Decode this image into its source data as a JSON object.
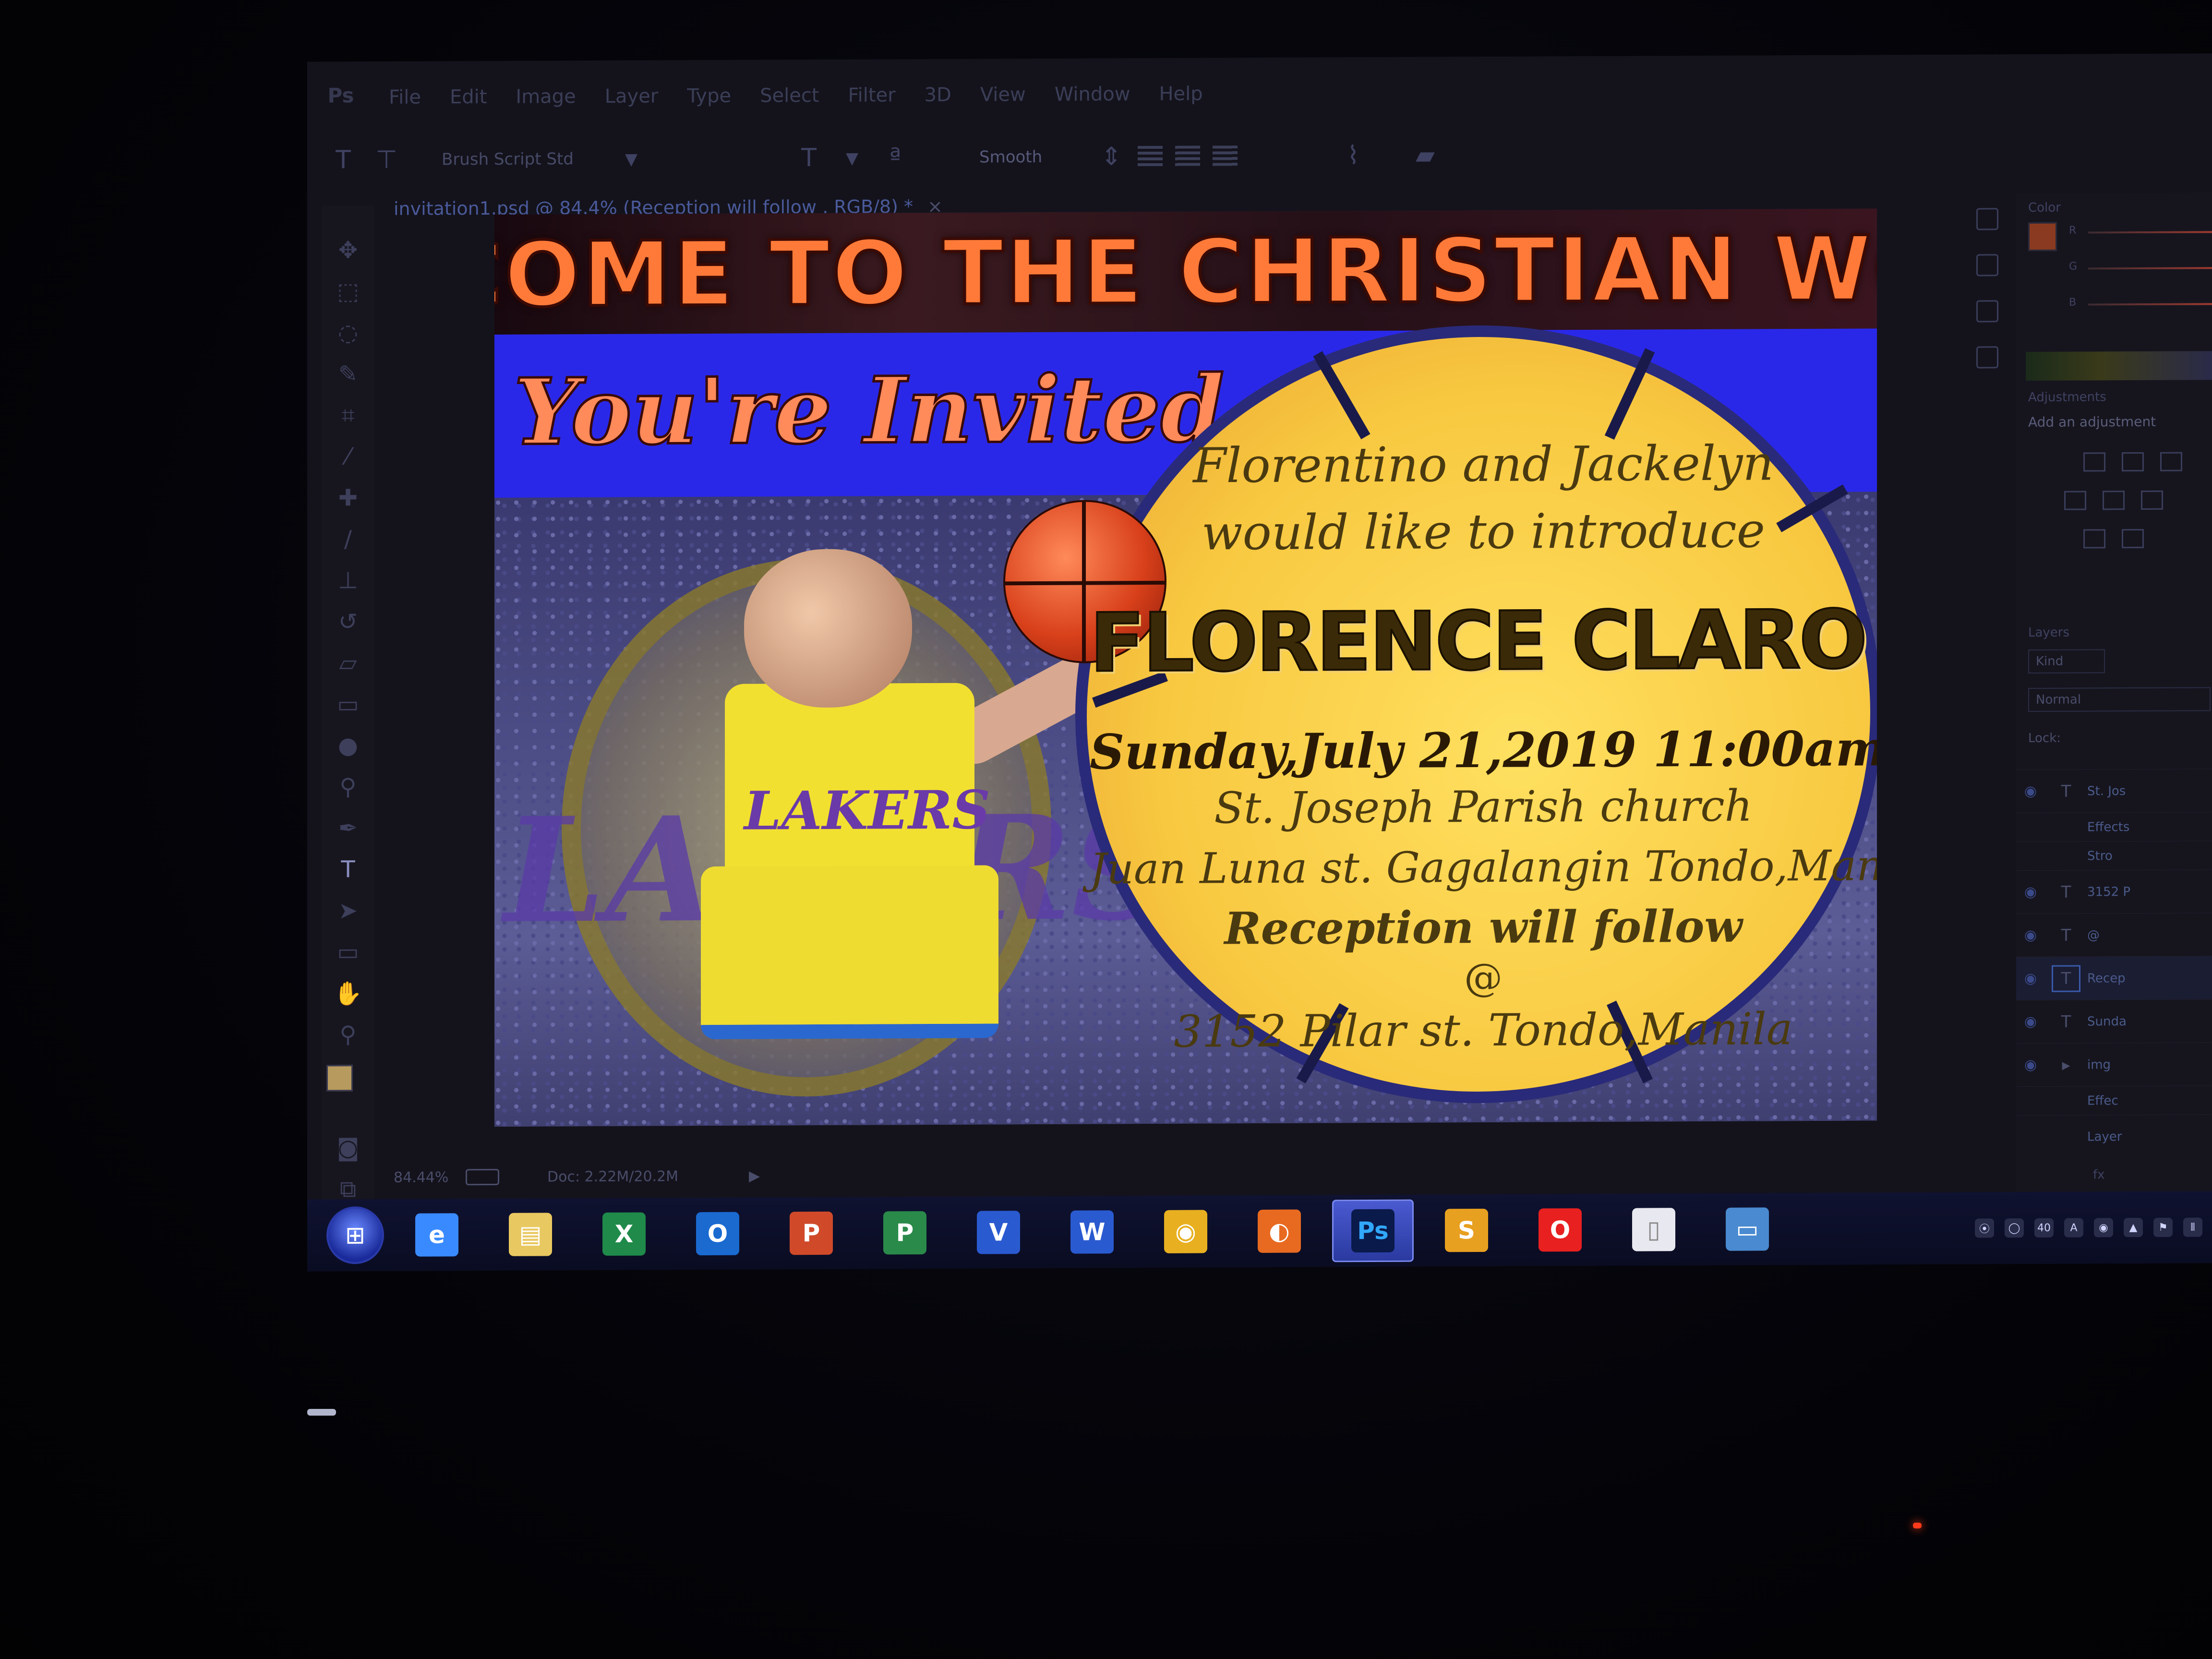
{
  "app": {
    "logo": "Ps"
  },
  "menu": [
    "File",
    "Edit",
    "Image",
    "Layer",
    "Type",
    "Select",
    "Filter",
    "3D",
    "View",
    "Window",
    "Help"
  ],
  "options_bar": {
    "font_family": "Brush Script Std",
    "antialias": "Smooth",
    "icons": [
      "type-tool-icon",
      "toggle-orientation-icon",
      "font-size-icon",
      "align-left-icon",
      "align-center-icon",
      "align-right-icon",
      "warp-text-icon",
      "character-panel-icon"
    ]
  },
  "document_tab": {
    "title": "invitation1.psd @ 84.4% (Reception will follow     , RGB/8) *",
    "close": "×"
  },
  "tools": [
    "move-tool-icon",
    "marquee-tool-icon",
    "lasso-tool-icon",
    "quick-select-tool-icon",
    "crop-tool-icon",
    "eyedropper-tool-icon",
    "healing-brush-tool-icon",
    "brush-tool-icon",
    "clone-stamp-tool-icon",
    "history-brush-tool-icon",
    "eraser-tool-icon",
    "gradient-tool-icon",
    "blur-tool-icon",
    "dodge-tool-icon",
    "pen-tool-icon",
    "type-tool-icon",
    "path-select-tool-icon",
    "shape-tool-icon",
    "hand-tool-icon",
    "zoom-tool-icon"
  ],
  "swatches": {
    "foreground": "#b79a5d",
    "background": "#e6e6f2"
  },
  "invitation": {
    "banner": "WELCOME TO THE CHRISTIAN WORLD",
    "invited": "You're Invited",
    "intro_line1": "Florentino and Jackelyn",
    "intro_line2": "would like to introduce",
    "name": "FLORENCE CLARO PEÑALBER",
    "date_time": "Sunday,July 21,2019 11:00am",
    "church": "St. Joseph Parish church",
    "church_address": "Juan Luna st. Gagalangin Tondo,Manila",
    "reception": "Reception will follow",
    "at": "@",
    "reception_address": "3152 Pilar st. Tondo,Manila",
    "background_words": {
      "lakers": "LAKERS",
      "jersey": "LAKERS"
    }
  },
  "status_bar": {
    "zoom": "84.44%",
    "doc": "Doc: 2.22M/20.2M",
    "arrow": "▶"
  },
  "panels": {
    "color_title": "Color",
    "color_channels": [
      "R",
      "G",
      "B"
    ],
    "adjustments_title": "Adjustments",
    "adjustments_hint": "Add an adjustment",
    "layers_title": "Layers",
    "kind": "Kind",
    "blend_mode": "Normal",
    "lock": "Lock:",
    "layers": [
      {
        "type": "T",
        "name": "St. Jos"
      },
      {
        "type": "",
        "name": "Effects"
      },
      {
        "type": "",
        "name": "Stro"
      },
      {
        "type": "T",
        "name": "3152 P"
      },
      {
        "type": "T",
        "name": "@"
      },
      {
        "type": "T",
        "name": "Recep"
      },
      {
        "type": "T",
        "name": "Sunda"
      },
      {
        "type": "▸",
        "name": "img"
      },
      {
        "type": "",
        "name": "Effec"
      },
      {
        "type": "",
        "name": "Layer"
      }
    ],
    "fx": "fx"
  },
  "taskbar": {
    "start": "⊞",
    "apps": [
      {
        "name": "internet-explorer",
        "label": "e",
        "color": "#3a8aff"
      },
      {
        "name": "file-explorer",
        "label": "▤",
        "color": "#e8c860"
      },
      {
        "name": "excel",
        "label": "X",
        "color": "#1f8a4a"
      },
      {
        "name": "outlook",
        "label": "O",
        "color": "#1a6ad0"
      },
      {
        "name": "powerpoint",
        "label": "P",
        "color": "#d04a2a"
      },
      {
        "name": "project",
        "label": "P",
        "color": "#2a8a4a"
      },
      {
        "name": "visio",
        "label": "V",
        "color": "#2a5ad0"
      },
      {
        "name": "word",
        "label": "W",
        "color": "#2a5ad0"
      },
      {
        "name": "chrome",
        "label": "◉",
        "color": "#e8b020"
      },
      {
        "name": "firefox",
        "label": "◐",
        "color": "#e86a20"
      },
      {
        "name": "photoshop",
        "label": "Ps",
        "color": "#0a1a4a"
      },
      {
        "name": "sublime",
        "label": "S",
        "color": "#e8a020"
      },
      {
        "name": "opera",
        "label": "O",
        "color": "#e82020"
      },
      {
        "name": "blank-document",
        "label": "▯",
        "color": "#e8e8f0"
      },
      {
        "name": "screen-app",
        "label": "▭",
        "color": "#4a8ad0"
      }
    ],
    "tray": [
      "⦿",
      "◯",
      "40",
      "A",
      "◉",
      "▲",
      "⚑",
      "⦀"
    ]
  }
}
